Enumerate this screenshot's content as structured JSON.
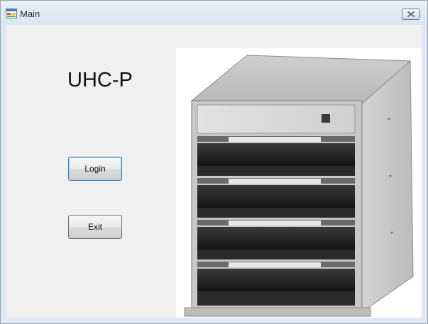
{
  "window": {
    "title": "Main",
    "app_icon": "windows-form-icon",
    "close_icon": "close-icon"
  },
  "main": {
    "app_title": "UHC-P",
    "login_label": "Login",
    "exit_label": "Exit",
    "product_image": "uhc-p holding cabinet photo"
  },
  "colors": {
    "client_bg": "#f0f0f0",
    "focus_border": "#3c7fb1"
  }
}
